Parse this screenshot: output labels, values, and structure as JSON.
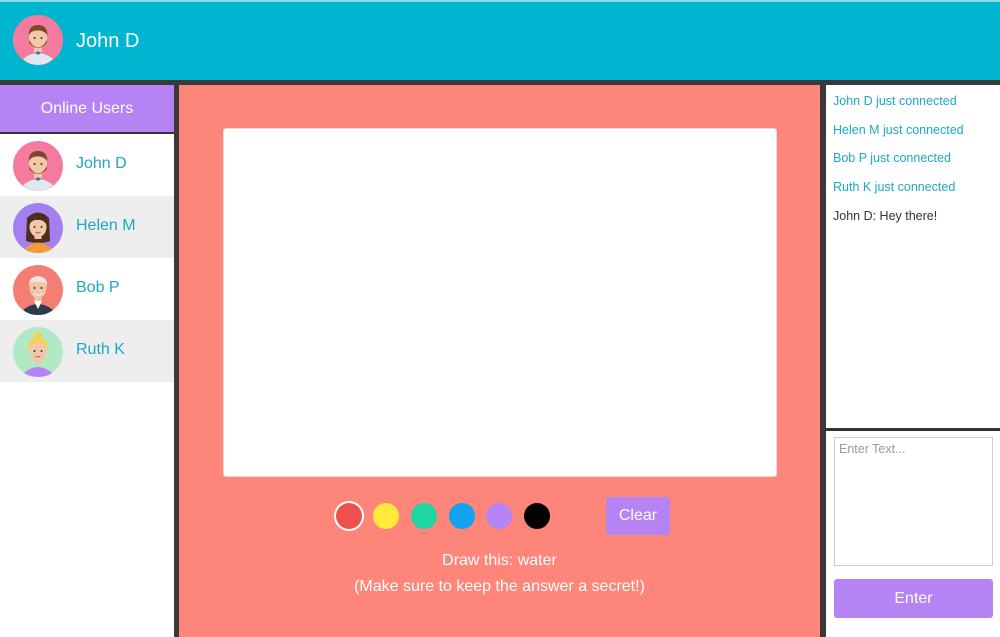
{
  "header": {
    "current_user": "John D",
    "avatar": "man-with-beard-avatar"
  },
  "sidebar": {
    "title": "Online Users",
    "users": [
      {
        "name": "John D",
        "avatar": "man-with-beard-avatar"
      },
      {
        "name": "Helen M",
        "avatar": "woman-avatar"
      },
      {
        "name": "Bob P",
        "avatar": "old-man-avatar"
      },
      {
        "name": "Ruth K",
        "avatar": "blonde-woman-avatar"
      }
    ]
  },
  "board": {
    "palette": [
      {
        "name": "red",
        "color": "#f0504c",
        "selected": true
      },
      {
        "name": "yellow",
        "color": "#ffea3b"
      },
      {
        "name": "green",
        "color": "#1fd6a4"
      },
      {
        "name": "blue",
        "color": "#12a3ee"
      },
      {
        "name": "purple",
        "color": "#b583f4"
      },
      {
        "name": "black",
        "color": "#000000"
      }
    ],
    "clear_label": "Clear",
    "prompt_line1": "Draw this: water",
    "prompt_line2": "(Make sure to keep the answer a secret!)"
  },
  "chat": {
    "messages": [
      {
        "text": "John D just connected",
        "kind": "system"
      },
      {
        "text": "Helen M just connected",
        "kind": "system"
      },
      {
        "text": "Bob P just connected",
        "kind": "system"
      },
      {
        "text": "Ruth K just connected",
        "kind": "system"
      },
      {
        "text": "John D: Hey there!",
        "kind": "user"
      }
    ],
    "input_placeholder": "Enter Text...",
    "enter_label": "Enter"
  },
  "colors": {
    "header_bg": "#00b5cf",
    "accent_purple": "#b583f4",
    "board_bg": "#fd857a",
    "link_cyan": "#1ea8c5"
  }
}
